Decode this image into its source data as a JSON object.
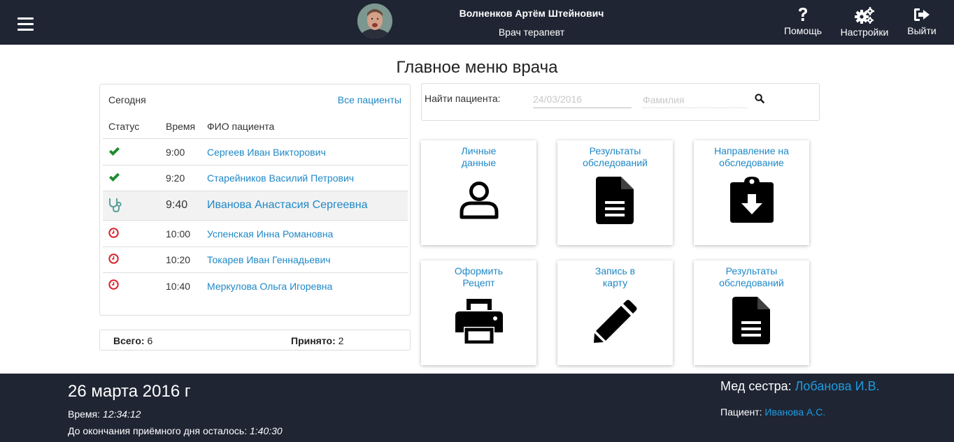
{
  "header": {
    "doctor_name": "Волненков Артём Штейнович",
    "doctor_role": "Врач терапевт",
    "help_label": "Помощь",
    "settings_label": "Настройки",
    "exit_label": "Выйти"
  },
  "page": {
    "title": "Главное меню врача"
  },
  "patients": {
    "today_label": "Сегодня",
    "all_link": "Все пациенты",
    "columns": {
      "status": "Статус",
      "time": "Время",
      "name": "ФИО пациента"
    },
    "rows": [
      {
        "status": "check-icon",
        "time": "9:00",
        "name": "Сергеев Иван Викторович"
      },
      {
        "status": "check-icon",
        "time": "9:20",
        "name": "Старейников Василий Петрович"
      },
      {
        "status": "stethoscope-icon",
        "time": "9:40",
        "name": "Иванова Анастасия Сергеевна"
      },
      {
        "status": "clock-icon",
        "time": "10:00",
        "name": "Успенская Инна Романовна"
      },
      {
        "status": "clock-icon",
        "time": "10:20",
        "name": "Токарев Иван Геннадьевич"
      },
      {
        "status": "clock-icon",
        "time": "10:40",
        "name": "Меркулова Ольга Игоревна"
      }
    ]
  },
  "summary": {
    "total_label": "Всего:",
    "total_value": "6",
    "accepted_label": "Принято:",
    "accepted_value": "2"
  },
  "search": {
    "label": "Найти пациента:",
    "date_placeholder": "24/03/2016",
    "name_placeholder": "Фамилия"
  },
  "tiles": [
    {
      "line1": "Личные",
      "line2": "данные",
      "icon": "person-icon"
    },
    {
      "line1": "Результаты",
      "line2": "обследований",
      "icon": "document-icon"
    },
    {
      "line1": "Направление на",
      "line2": "обследование",
      "icon": "clipboard-download-icon"
    },
    {
      "line1": "Оформить",
      "line2": "Рецепт",
      "icon": "printer-icon"
    },
    {
      "line1": "Запись в",
      "line2": "карту",
      "icon": "pencil-icon"
    },
    {
      "line1": "Результаты",
      "line2": "обследований",
      "icon": "document-icon"
    }
  ],
  "footer": {
    "date": "26 марта 2016 г",
    "time_label": "Время:",
    "time_value": "12:34:12",
    "remaining_label": "До окончания приёмного дня осталось:",
    "remaining_value": "1:40:30",
    "nurse_label": "Мед сестра:",
    "nurse_value": "Лобанова И.В.",
    "patient_label": "Пациент:",
    "patient_value": "Иванова А.С."
  },
  "colors": {
    "header_bg": "#1f2533",
    "link": "#1e88c7",
    "check": "#1e8c2e",
    "clock": "#d9232d",
    "stethoscope": "#5aa09a"
  }
}
